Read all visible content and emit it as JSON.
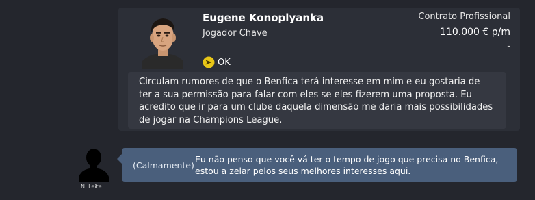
{
  "player": {
    "name": "Eugene Konoplyanka",
    "role": "Jogador Chave",
    "contract_type": "Contrato Profissional",
    "salary": "110.000 € p/m",
    "extra": "-",
    "status_label": "OK",
    "status_icon": "yellow-arrow-right-icon"
  },
  "message": {
    "text": "Circulam rumores de que o Benfica terá interesse em mim e eu gostaria de ter a sua permissão para falar com eles se eles fizerem uma proposta. Eu acredito que ir para um clube daquela dimensão me daria mais possibilidades de jogar na Champions League."
  },
  "manager": {
    "name": "N. Leite"
  },
  "reply": {
    "tone": "(Calmamente)",
    "text": "Eu não penso que você vá ter o tempo de jogo que precisa no Benfica, estou a zelar pelos seus melhores interesses aqui."
  },
  "colors": {
    "background": "#24262d",
    "card": "#2c2f37",
    "message_bubble": "#353841",
    "reply_bubble": "#4a5f7c",
    "status_icon": "#e8c617"
  }
}
